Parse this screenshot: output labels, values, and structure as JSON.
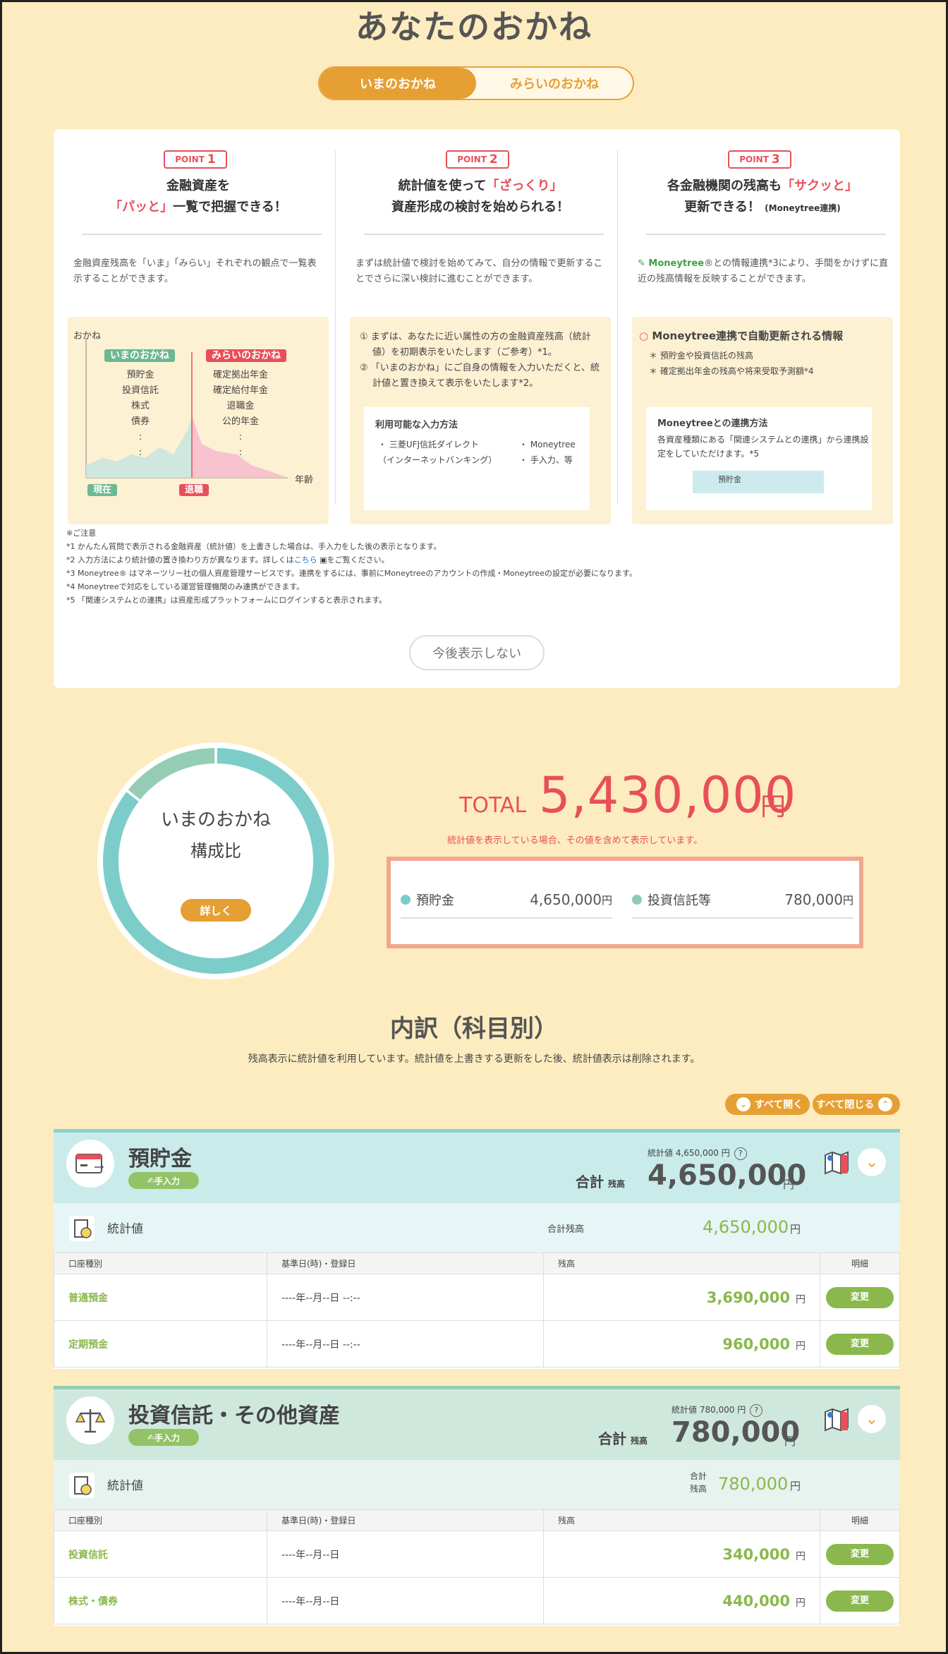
{
  "title": "あなたのおかね",
  "tabs": {
    "now": "いまのおかね",
    "future": "みらいのおかね"
  },
  "points": [
    {
      "badge": "POINT",
      "num": "1",
      "line1_pre": "金融資産を",
      "line1_red": "",
      "line1_post": "",
      "line2_pre": "",
      "line2_red": "「パッと」",
      "line2_post": "一覧で把握できる！",
      "desc": "金融資産残高を「いま」「みらい」それぞれの観点で一覧表示することができます。"
    },
    {
      "badge": "POINT",
      "num": "2",
      "line1_pre": "統計値を使って",
      "line1_red": "「ざっくり」",
      "line1_post": "",
      "line2_pre": "資産形成の検討を始められる！",
      "line2_red": "",
      "line2_post": "",
      "desc": "まずは統計値で検討を始めてみて、自分の情報で更新することでさらに深い検討に進むことができます。"
    },
    {
      "badge": "POINT",
      "num": "3",
      "line1_pre": "各金融機関の残高も",
      "line1_red": "「サクッと」",
      "line1_post": "",
      "line2_pre": "更新できる！",
      "line2_red": "",
      "line2_post": "(Moneytree連携)",
      "desc": "®との情報連携*3により、手間をかけずに直近の残高情報を反映することができます。"
    }
  ],
  "p1box": {
    "axis_y": "おかね",
    "axis_x": "年齢",
    "now_tag": "いまのおかね",
    "future_tag": "みらいのおかね",
    "now_items": [
      "預貯金",
      "投資信託",
      "株式",
      "債券"
    ],
    "future_items": [
      "確定拠出年金",
      "確定給付年金",
      "退職金",
      "公的年金"
    ],
    "current": "現在",
    "retire": "退職"
  },
  "p2box": {
    "item1": "まずは、あなたに近い属性の方の金融資産残高（統計値）を初期表示をいたします（ご参考）*1。",
    "item2": "「いまのおかね」にご自身の情報を入力いただくと、統計値と置き換えて表示をいたします*2。",
    "methods_title": "利用可能な入力方法",
    "m1": "・ 三菱UFJ信託ダイレクト",
    "m1b": "（インターネットバンキング）",
    "m2": "・ Moneytree",
    "m3": "・ 手入力、等"
  },
  "p3box": {
    "brand": "Moneytree",
    "title": "Moneytree連携で自動更新される情報",
    "b1": "預貯金や投資信託の残高",
    "b2": "確定拠出年金の残高や将来受取予測額*4",
    "link_title": "Moneytreeとの連携方法",
    "link_desc": "各資産種類にある「関連システムとの連携」から連携設定をしていただけます。*5",
    "mini_label": "預貯金"
  },
  "notes": {
    "head": "※ご注意",
    "n1": "*1 かんたん質問で表示される金融資産（統計値）を上書きした場合は、手入力をした後の表示となります。",
    "n2_pre": "*2 入力方法により統計値の置き換わり方が異なります。詳しくは",
    "n2_link": "こちら",
    "n2_post": "をご覧ください。",
    "n3": "*3 Moneytree® はマネーツリー社の個人資産管理サービスです。連携をするには、事前にMoneytreeのアカウントの作成・Moneytreeの設定が必要になります。",
    "n4": "*4 Moneytreeで対応をしている運営管理機関のみ連携ができます。",
    "n5": "*5 「関連システムとの連携」は資産形成プラットフォームにログインすると表示されます。"
  },
  "hide_button": "今後表示しない",
  "donut": {
    "title1": "いまのおかね",
    "title2": "構成比",
    "detail": "詳しく"
  },
  "total": {
    "label": "TOTAL",
    "value": "5,430,000",
    "unit": "円",
    "note": "統計値を表示している場合、その値を含めて表示しています。"
  },
  "breakdown": [
    {
      "name": "預貯金",
      "value": "4,650,000",
      "unit": "円",
      "color": "#7ccdc9"
    },
    {
      "name": "投資信託等",
      "value": "780,000",
      "unit": "円",
      "color": "#8fcbb0"
    }
  ],
  "chart_data": {
    "type": "pie",
    "categories": [
      "預貯金",
      "投資信託等"
    ],
    "values": [
      4650000,
      780000
    ],
    "colors": [
      "#7ccdc9",
      "#94cdb4"
    ]
  },
  "section": {
    "title": "内訳（科目別）",
    "sub": "残高表示に統計値を利用しています。統計値を上書きする更新をした後、統計値表示は削除されます。",
    "open_all": "すべて開く",
    "close_all": "すべて閉じる"
  },
  "cards": [
    {
      "name": "預貯金",
      "manual": "手入力",
      "stat_small": "統計値 4,650,000 円",
      "sum_label": "合計",
      "sum_sub": "残高",
      "sum_value": "4,650,000",
      "unit": "円",
      "stat_label": "統計値",
      "stat_total_label": "合計残高",
      "stat_total_sub": "",
      "stat_value": "4,650,000",
      "headers": [
        "口座種別",
        "基準日(時)・登録日",
        "残高",
        "明細"
      ],
      "rows": [
        {
          "type": "普通預金",
          "date": "----年--月--日 --:--",
          "amount": "3,690,000",
          "unit": "円",
          "btn": "変更"
        },
        {
          "type": "定期預金",
          "date": "----年--月--日 --:--",
          "amount": "960,000",
          "unit": "円",
          "btn": "変更"
        }
      ]
    },
    {
      "name": "投資信託・その他資産",
      "manual": "手入力",
      "stat_small": "統計値 780,000 円",
      "sum_label": "合計",
      "sum_sub": "残高",
      "sum_value": "780,000",
      "unit": "円",
      "stat_label": "統計値",
      "stat_total_label": "合計",
      "stat_total_sub": "残高",
      "stat_value": "780,000",
      "headers": [
        "口座種別",
        "基準日(時)・登録日",
        "残高",
        "明細"
      ],
      "rows": [
        {
          "type": "投資信託",
          "date": "----年--月--日",
          "amount": "340,000",
          "unit": "円",
          "btn": "変更"
        },
        {
          "type": "株式・債券",
          "date": "----年--月--日",
          "amount": "440,000",
          "unit": "円",
          "btn": "変更"
        }
      ]
    }
  ]
}
